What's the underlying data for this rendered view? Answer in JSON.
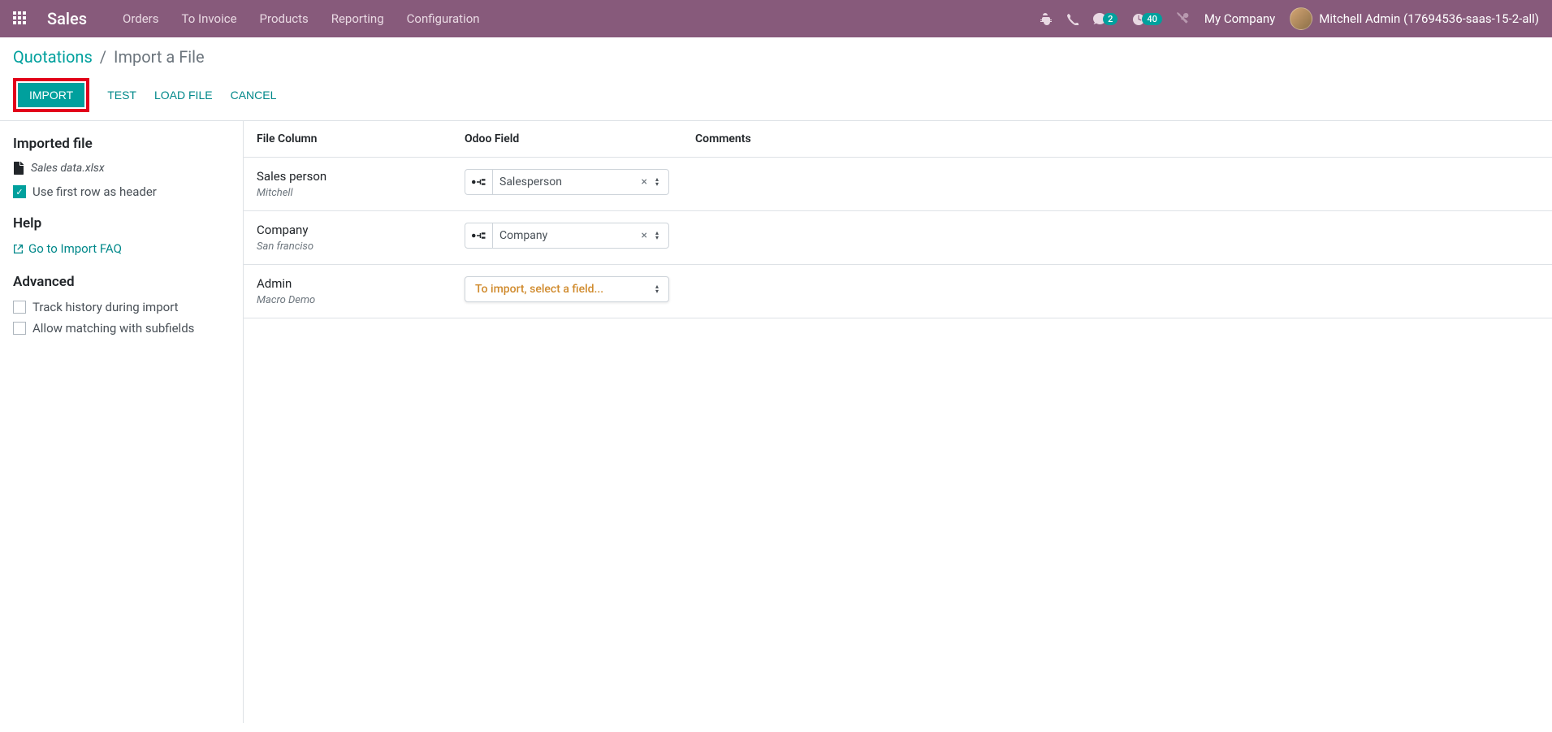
{
  "navbar": {
    "app_name": "Sales",
    "menu": [
      "Orders",
      "To Invoice",
      "Products",
      "Reporting",
      "Configuration"
    ],
    "messages_badge": "2",
    "activities_badge": "40",
    "company": "My Company",
    "user": "Mitchell Admin (17694536-saas-15-2-all)"
  },
  "breadcrumb": {
    "parent": "Quotations",
    "current": "Import a File"
  },
  "actions": {
    "import": "IMPORT",
    "test": "TEST",
    "load_file": "LOAD FILE",
    "cancel": "CANCEL"
  },
  "sidebar": {
    "imported_file_heading": "Imported file",
    "file_name": "Sales data.xlsx",
    "use_first_row": "Use first row as header",
    "help_heading": "Help",
    "faq_link": "Go to Import FAQ",
    "advanced_heading": "Advanced",
    "track_history": "Track history during import",
    "allow_subfields": "Allow matching with subfields"
  },
  "table": {
    "headers": {
      "file_column": "File Column",
      "odoo_field": "Odoo Field",
      "comments": "Comments"
    },
    "rows": [
      {
        "column": "Sales person",
        "sample": "Mitchell",
        "field": "Salesperson",
        "has_relation": true
      },
      {
        "column": "Company",
        "sample": "San franciso",
        "field": "Company",
        "has_relation": true
      },
      {
        "column": "Admin",
        "sample": "Macro Demo",
        "field": "To import, select a field...",
        "placeholder": true
      }
    ]
  }
}
